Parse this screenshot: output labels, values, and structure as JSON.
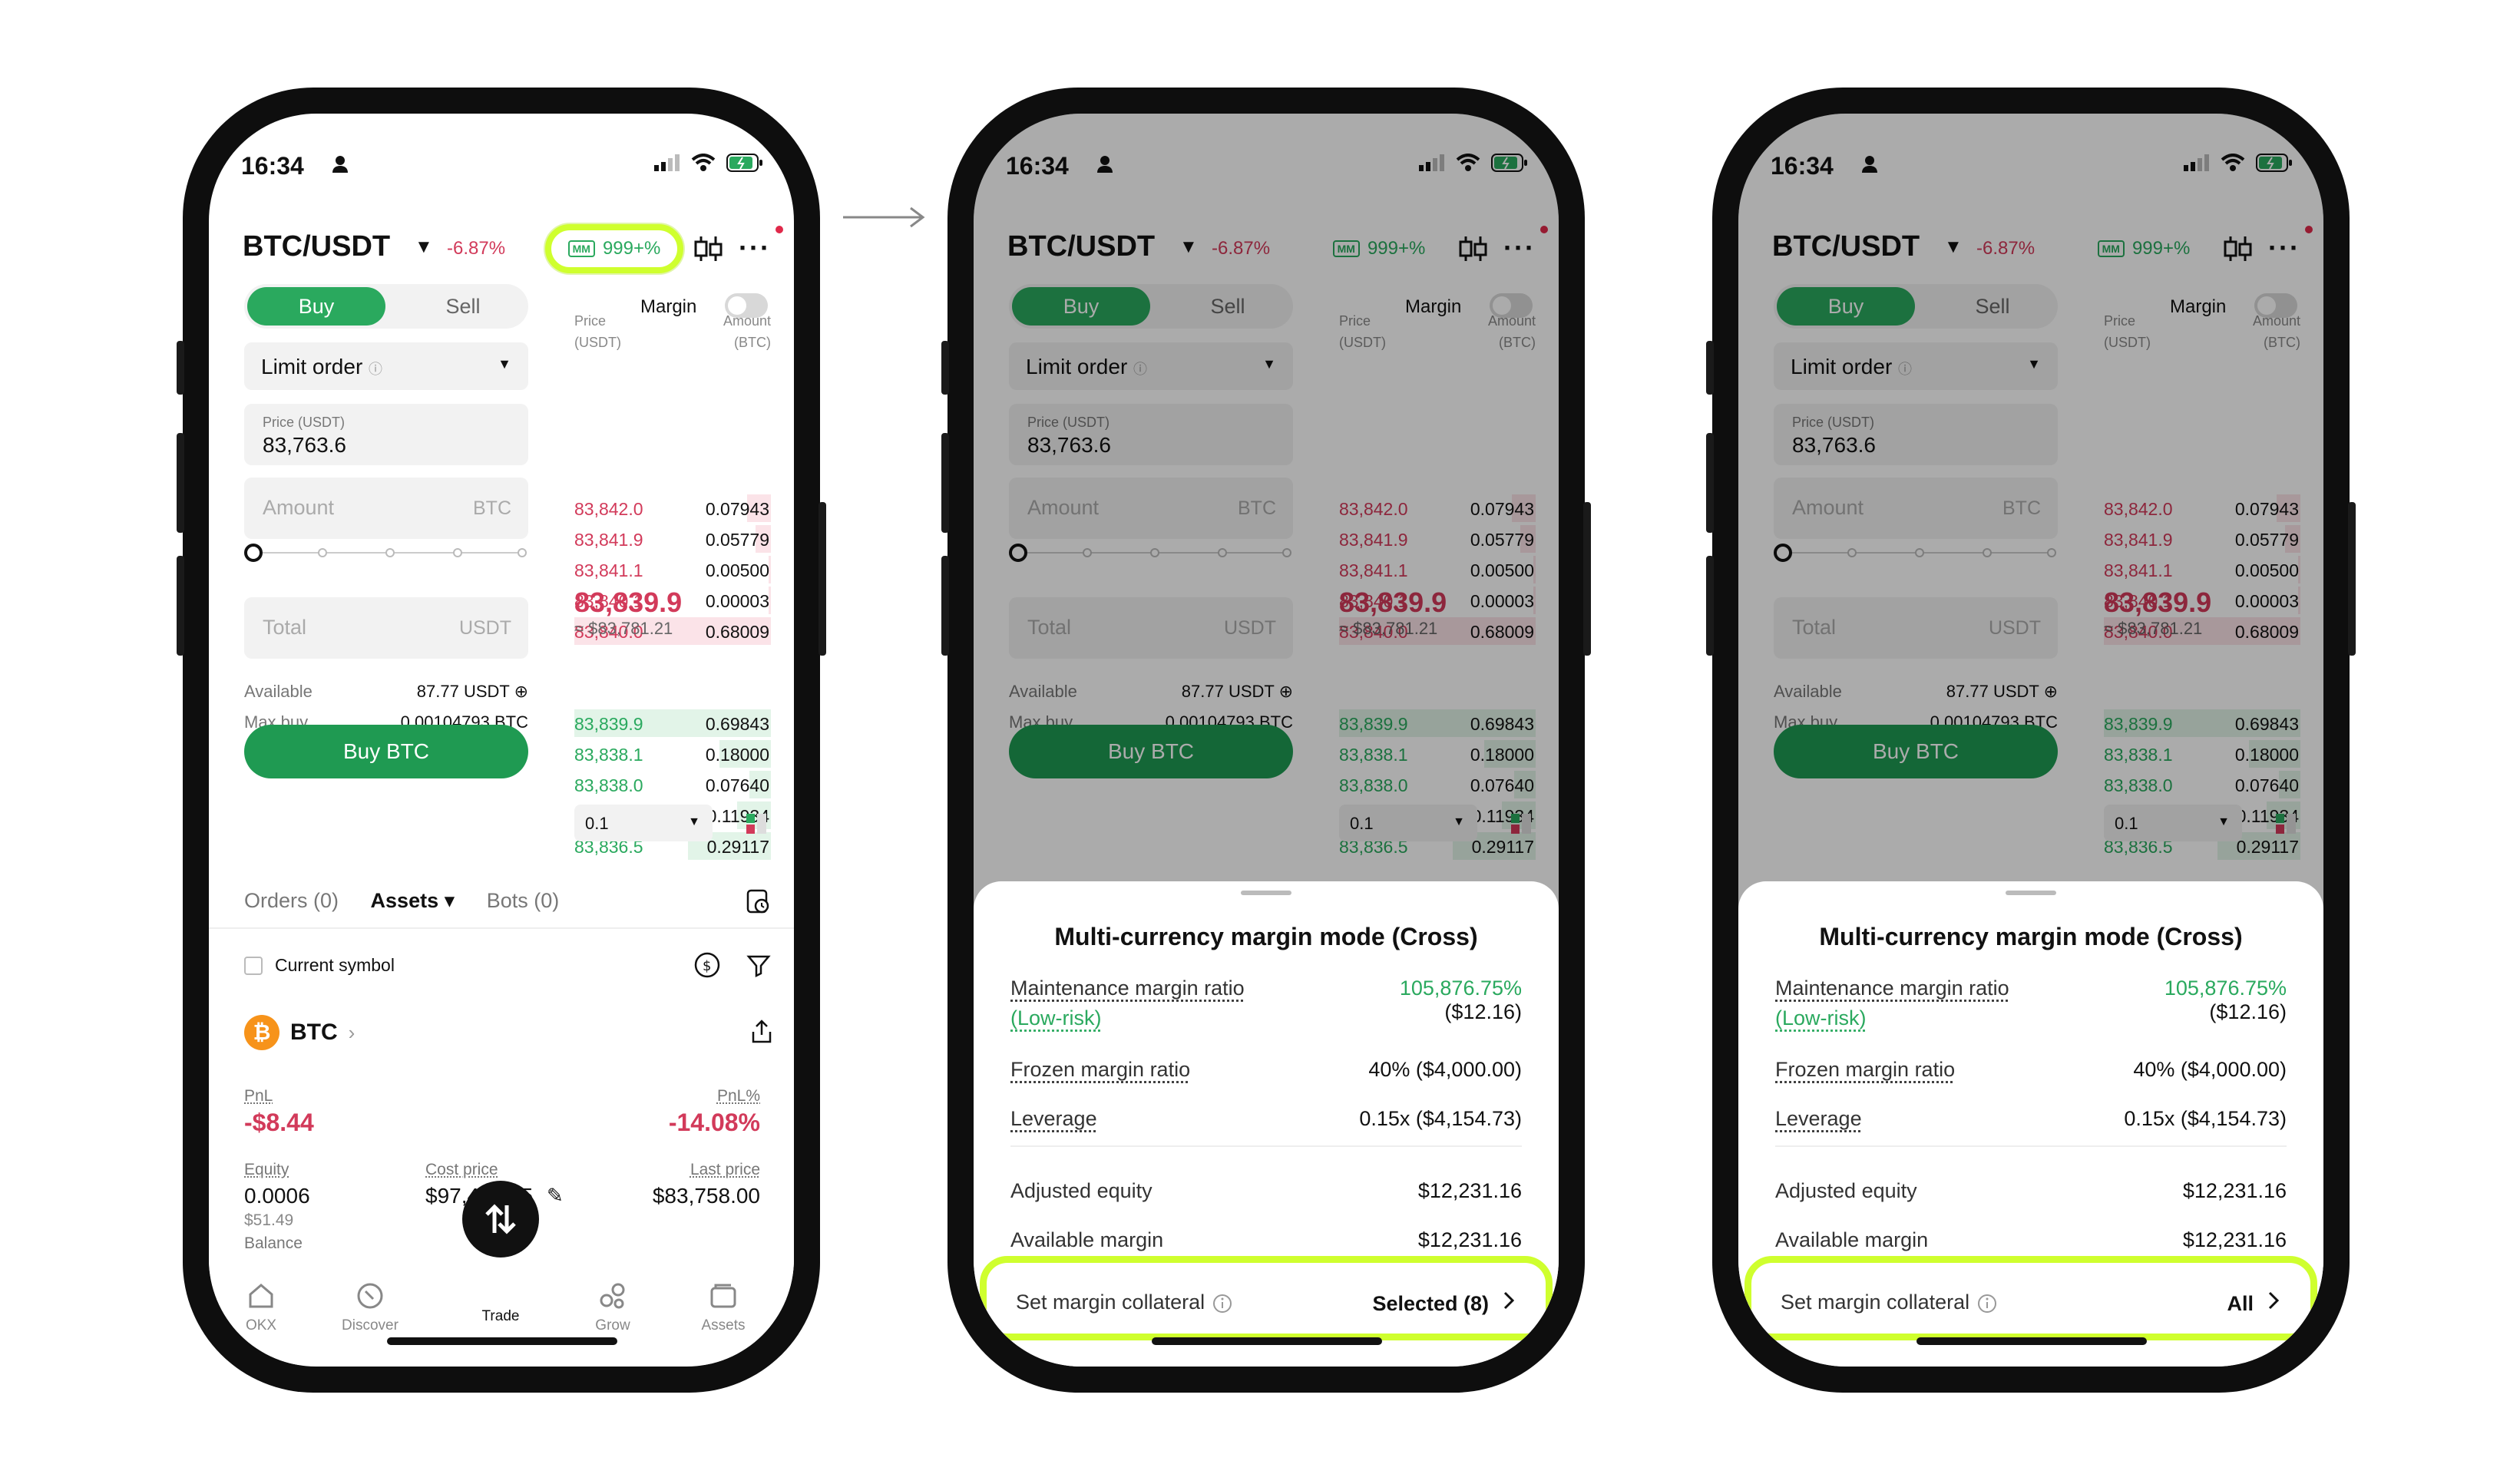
{
  "screens": [
    {
      "status_time": "16:34",
      "pair": "BTC/USDT",
      "change": "-6.87%",
      "leverage": "999+%",
      "mm_badge": "MM",
      "tabs": {
        "buy": "Buy",
        "sell": "Sell"
      },
      "margin_label": "Margin",
      "order_type": "Limit order",
      "price_field": {
        "label": "Price (USDT)",
        "value": "83,763.6"
      },
      "amount_field": {
        "placeholder": "Amount",
        "unit": "BTC"
      },
      "total_field": {
        "placeholder": "Total",
        "unit": "USDT"
      },
      "available": {
        "label": "Available",
        "value": "87.77 USDT"
      },
      "max_buy": {
        "label": "Max buy",
        "value": "0.00104793 BTC"
      },
      "buy_button": "Buy BTC",
      "book_header": {
        "price": "Price",
        "price_unit": "(USDT)",
        "amount": "Amount",
        "amount_unit": "(BTC)"
      },
      "asks": [
        {
          "price": "83,842.0",
          "amount": "0.07943",
          "depth": 0.12
        },
        {
          "price": "83,841.9",
          "amount": "0.05779",
          "depth": 0.08
        },
        {
          "price": "83,841.1",
          "amount": "0.00500",
          "depth": 0.01
        },
        {
          "price": "83,840.1",
          "amount": "0.00003",
          "depth": 0.01
        },
        {
          "price": "83,840.0",
          "amount": "0.68009",
          "depth": 1.0
        }
      ],
      "last_price": "83,839.9",
      "last_price_usd": "≈ $83,781.21",
      "bids": [
        {
          "price": "83,839.9",
          "amount": "0.69843",
          "depth": 1.0
        },
        {
          "price": "83,838.1",
          "amount": "0.18000",
          "depth": 0.26
        },
        {
          "price": "83,838.0",
          "amount": "0.07640",
          "depth": 0.11
        },
        {
          "price": "83,837.4",
          "amount": "0.11934",
          "depth": 0.17
        },
        {
          "price": "83,836.5",
          "amount": "0.29117",
          "depth": 0.42
        }
      ],
      "depth_step": "0.1",
      "orders_tabs": [
        "Orders (0)",
        "Assets",
        "Bots (0)"
      ],
      "current_symbol": "Current symbol",
      "asset": "BTC",
      "pnl": {
        "label": "PnL",
        "value": "-$8.44"
      },
      "pnl_pct": {
        "label": "PnL%",
        "value": "-14.08%"
      },
      "equity": {
        "label": "Equity",
        "value": "0.0006",
        "sub": "$51.49"
      },
      "cost_price": {
        "label": "Cost price",
        "value": "$97,485.45"
      },
      "last_price_label": {
        "label": "Last price",
        "value": "$83,758.00"
      },
      "balance_label": "Balance",
      "nav": [
        "OKX",
        "Discover",
        "Trade",
        "Grow",
        "Assets"
      ]
    }
  ],
  "sheet": {
    "title": "Multi-currency margin mode (Cross)",
    "mmr_label": "Maintenance margin ratio",
    "mmr_risk": "(Low-risk)",
    "mmr_value": "105,876.75%",
    "mmr_amount": "($12.16)",
    "frozen_label": "Frozen margin ratio",
    "frozen_value": "40% ($4,000.00)",
    "leverage_label": "Leverage",
    "leverage_value": "0.15x ($4,154.73)",
    "adj_equity_label": "Adjusted equity",
    "adj_equity_value": "$12,231.16",
    "avail_margin_label": "Available margin",
    "avail_margin_value": "$12,231.16",
    "collateral_label": "Set margin collateral",
    "collateral_value_a": "Selected (8)",
    "collateral_value_b": "All"
  },
  "colors": {
    "accent_green": "#2aa95e",
    "red": "#d23a5a",
    "highlight": "#cfff2e"
  }
}
